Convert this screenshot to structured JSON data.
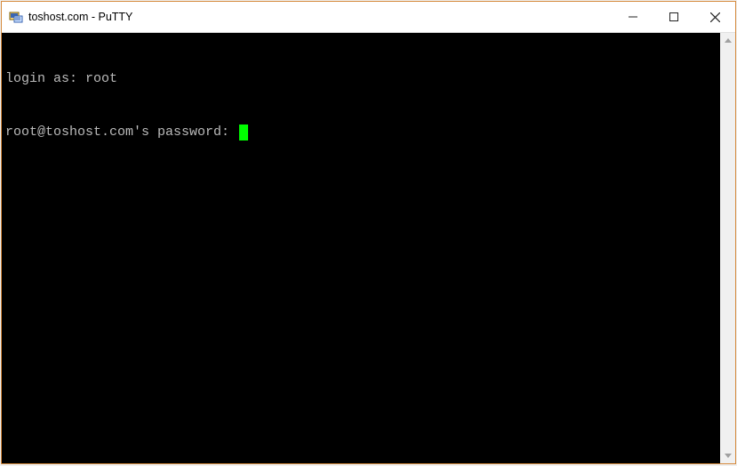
{
  "window": {
    "title": "toshost.com - PuTTY"
  },
  "terminal": {
    "line1_prompt": "login as: ",
    "line1_input": "root",
    "line2_prompt": "root@toshost.com's password: "
  }
}
